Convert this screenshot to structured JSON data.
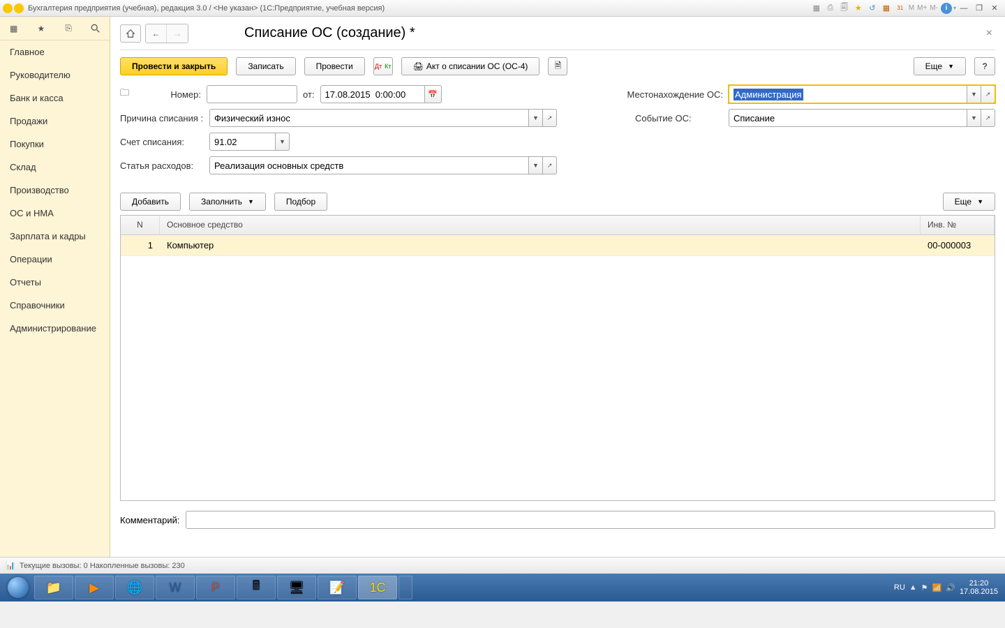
{
  "window": {
    "title": "Бухгалтерия предприятия (учебная), редакция 3.0 / <Не указан>  (1С:Предприятие, учебная версия)",
    "mcalc": [
      "M",
      "M+",
      "M-"
    ]
  },
  "sidebar": {
    "items": [
      {
        "label": "Главное"
      },
      {
        "label": "Руководителю"
      },
      {
        "label": "Банк и касса"
      },
      {
        "label": "Продажи"
      },
      {
        "label": "Покупки"
      },
      {
        "label": "Склад"
      },
      {
        "label": "Производство"
      },
      {
        "label": "ОС и НМА"
      },
      {
        "label": "Зарплата и кадры"
      },
      {
        "label": "Операции"
      },
      {
        "label": "Отчеты"
      },
      {
        "label": "Справочники"
      },
      {
        "label": "Администрирование"
      }
    ]
  },
  "page": {
    "title": "Списание ОС (создание) *",
    "buttons": {
      "post_and_close": "Провести и закрыть",
      "write": "Записать",
      "post": "Провести",
      "print_act": "Акт о списании ОС (ОС-4)",
      "more": "Еще",
      "help": "?"
    },
    "form": {
      "number_label": "Номер:",
      "number_value": "",
      "from_label": "от:",
      "date_value": "17.08.2015  0:00:00",
      "location_label": "Местонахождение ОС:",
      "location_value": "Администрация",
      "reason_label": "Причина списания :",
      "reason_value": "Физический износ",
      "event_label": "Событие ОС:",
      "event_value": "Списание",
      "account_label": "Счет списания:",
      "account_value": "91.02",
      "expense_label": "Статья расходов:",
      "expense_value": "Реализация основных средств"
    },
    "table_buttons": {
      "add": "Добавить",
      "fill": "Заполнить",
      "select": "Подбор",
      "more": "Еще"
    },
    "table": {
      "headers": {
        "n": "N",
        "name": "Основное средство",
        "inv": "Инв. №"
      },
      "rows": [
        {
          "n": "1",
          "name": "Компьютер",
          "inv": "00-000003"
        }
      ]
    },
    "comment_label": "Комментарий:",
    "comment_value": ""
  },
  "statusbar": {
    "text": "Текущие вызовы: 0   Накопленные вызовы: 230"
  },
  "taskbar": {
    "lang": "RU",
    "time": "21:20",
    "date": "17.08.2015"
  }
}
